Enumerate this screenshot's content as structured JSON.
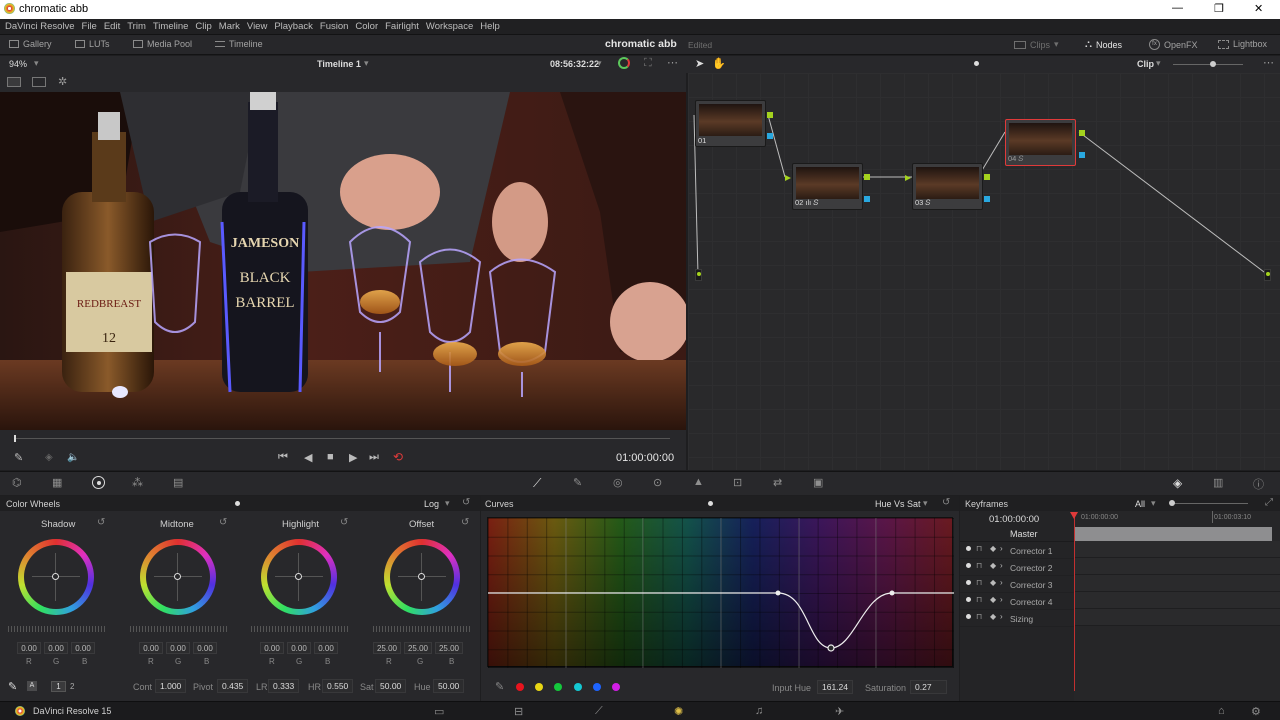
{
  "window": {
    "title": "chromatic abb",
    "minimize": "—",
    "maximize": "❐",
    "close": "✕"
  },
  "menu": [
    "DaVinci Resolve",
    "File",
    "Edit",
    "Trim",
    "Timeline",
    "Clip",
    "Mark",
    "View",
    "Playback",
    "Fusion",
    "Color",
    "Fairlight",
    "Workspace",
    "Help"
  ],
  "toolbar": {
    "gallery": "Gallery",
    "luts": "LUTs",
    "media_pool": "Media Pool",
    "timeline": "Timeline",
    "project_name": "chromatic abb",
    "edited": "Edited",
    "clips": "Clips",
    "nodes": "Nodes",
    "openfx": "OpenFX",
    "lightbox": "Lightbox"
  },
  "viewer": {
    "zoom": "94%",
    "timeline_name": "Timeline 1",
    "source_timecode": "08:56:32:22",
    "record_timecode": "01:00:00:00"
  },
  "viewer_image": {
    "bottle1_label_1": "REDBREAST",
    "bottle1_label_2": "12",
    "bottle2_label_1": "JAMESON",
    "bottle2_label_2": "BLACK",
    "bottle2_label_3": "BARREL"
  },
  "node_editor": {
    "mode": "Clip"
  },
  "nodes": [
    {
      "label": "01"
    },
    {
      "label": "02 ılı 𝑆"
    },
    {
      "label": "03 𝑆"
    },
    {
      "label": "04 𝑆"
    }
  ],
  "color_wheels": {
    "title": "Color Wheels",
    "mode": "Log",
    "wheels": [
      {
        "name": "Shadow",
        "r": "0.00",
        "g": "0.00",
        "b": "0.00"
      },
      {
        "name": "Midtone",
        "r": "0.00",
        "g": "0.00",
        "b": "0.00"
      },
      {
        "name": "Highlight",
        "r": "0.00",
        "g": "0.00",
        "b": "0.00"
      },
      {
        "name": "Offset",
        "r": "25.00",
        "g": "25.00",
        "b": "25.00"
      }
    ],
    "channel_labels": [
      "R",
      "G",
      "B"
    ],
    "page1": "1",
    "page2": "2",
    "cont_label": "Cont",
    "cont": "1.000",
    "pivot_label": "Pivot",
    "pivot": "0.435",
    "lr_label": "LR",
    "lr": "0.333",
    "hr_label": "HR",
    "hr": "0.550",
    "sat_label": "Sat",
    "sat": "50.00",
    "hue_label": "Hue",
    "hue": "50.00"
  },
  "curves": {
    "title": "Curves",
    "mode": "Hue Vs Sat",
    "input_hue_label": "Input Hue",
    "input_hue": "161.24",
    "saturation_label": "Saturation",
    "saturation": "0.27",
    "swatches": [
      "#e8141e",
      "#e8d614",
      "#14c83c",
      "#14c8d2",
      "#1e64ff",
      "#d21ee6"
    ]
  },
  "keyframes": {
    "title": "Keyframes",
    "filter": "All",
    "timecode": "01:00:00:00",
    "tick1": "01:00:00:00",
    "tick2": "01:00:03:10",
    "master": "Master",
    "tracks": [
      "Corrector 1",
      "Corrector 2",
      "Corrector 3",
      "Corrector 4",
      "Sizing"
    ]
  },
  "bottom": {
    "app_name": "DaVinci Resolve 15"
  },
  "colors": {
    "accent_red": "#e03a3a",
    "node_green": "#a4d21e",
    "node_blue": "#29a8e0",
    "panel_bg": "#1e1e20"
  }
}
